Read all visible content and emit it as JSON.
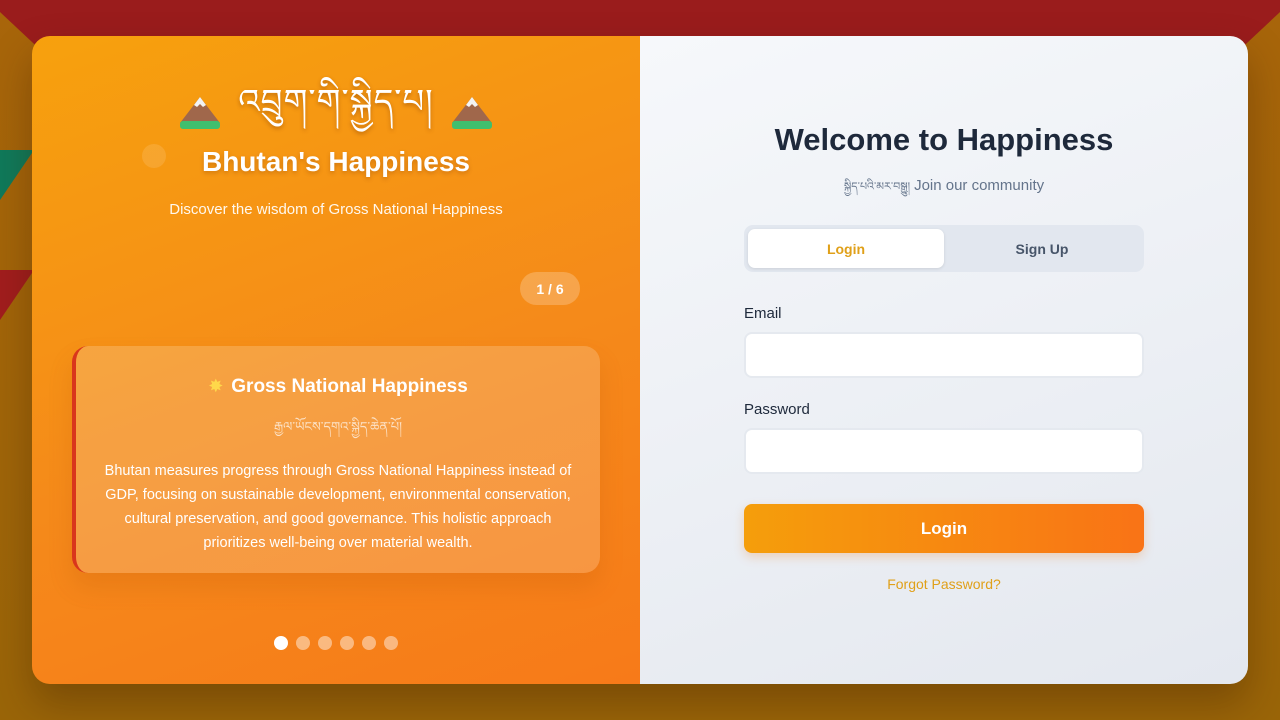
{
  "left_panel": {
    "dzongkha_title": "འབྲུག་གི་སྐྱིད་པ།",
    "title": "Bhutan's Happiness",
    "subtitle": "Discover the wisdom of Gross National Happiness",
    "counter": "1 / 6",
    "slide": {
      "title": "Gross National Happiness",
      "dzongkha": "རྒྱལ་ཡོངས་དགའ་སྐྱིད་ཆེན་པོ།",
      "body": "Bhutan measures progress through Gross National Happiness instead of GDP, focusing on sustainable development, environmental conservation, cultural preservation, and good governance. This holistic approach prioritizes well-being over material wealth."
    },
    "dots": [
      true,
      false,
      false,
      false,
      false,
      false
    ]
  },
  "right_panel": {
    "title": "Welcome to Happiness",
    "community_dz": "སྐྱིད་པའི་མར་བསྒྱུ།",
    "community": "Join our community",
    "tabs": [
      "Login",
      "Sign Up"
    ],
    "active_tab": "Login",
    "email_label": "Email",
    "email_value": "",
    "password_label": "Password",
    "password_value": "",
    "login_button": "Login",
    "forgot": "Forgot Password?"
  },
  "colors": {
    "accent": "#f59e0b",
    "accent_end": "#f97316",
    "heading": "#1e293b",
    "background_red": "#9a1c1c"
  }
}
